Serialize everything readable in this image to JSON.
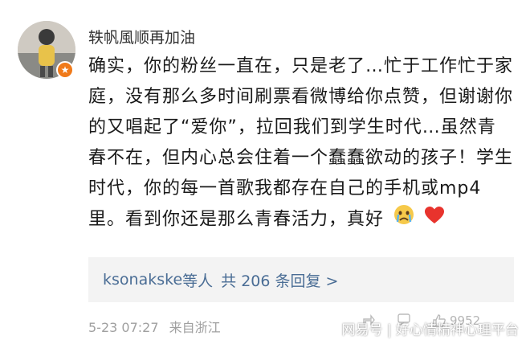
{
  "comment": {
    "username": "轶帆風顺再加油",
    "verified_badge_icon": "verified-badge-icon",
    "text": "确实，你的粉丝一直在，只是老了…忙于工作忙于家庭，没有那么多时间刷票看微博给你点赞，但谢谢你的又唱起了“爱你”，拉回我们到学生时代…虽然青春不在，但内心总会住着一个蠢蠢欲动的孩子！学生时代，你的每一首歌我都存在自己的手机或mp4里。看到你还是那么青春活力，真好",
    "emojis": [
      "crying-face-icon",
      "red-heart-icon"
    ],
    "replies": {
      "user": "ksonakske",
      "suffix": "等人",
      "count_text": "共 206 条回复 >"
    },
    "date": "5-23 07:27",
    "source": "来自浙江",
    "like_count_partial": "9952"
  },
  "watermark": "网易号 | 好心情精神心理平台",
  "colors": {
    "link": "#4a6d95",
    "meta": "#a0a0a0",
    "reply_bg": "#f3f3f3",
    "badge": "#f07a1a"
  }
}
